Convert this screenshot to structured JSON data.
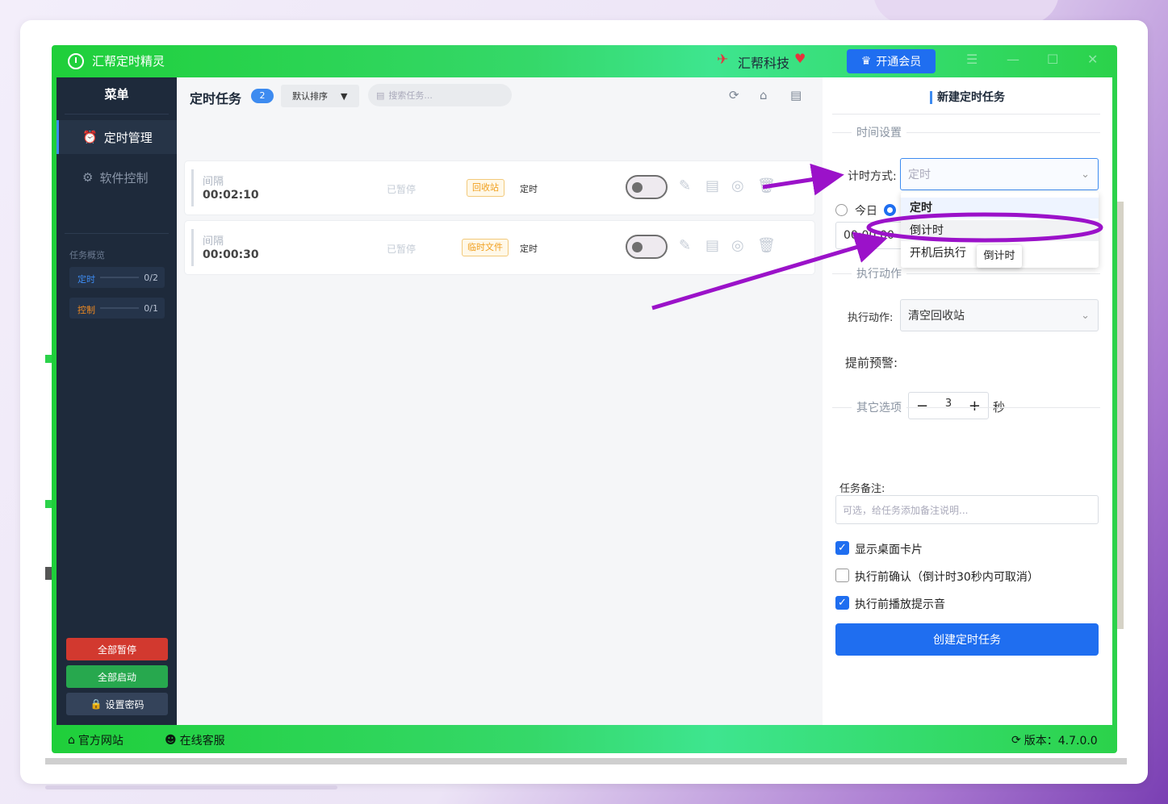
{
  "app": {
    "title": "汇帮定时精灵",
    "brand": "汇帮科技",
    "vip_label": "开通会员"
  },
  "sidebar": {
    "menu_title": "菜单",
    "items": [
      {
        "label": "定时管理",
        "icon": "alarm-clock-icon",
        "active": true
      },
      {
        "label": "软件控制",
        "icon": "gear-icon",
        "active": false
      }
    ],
    "overview_title": "任务概览",
    "overview": [
      {
        "label": "定时",
        "value": "0/2",
        "color": "#3d8bf0"
      },
      {
        "label": "控制",
        "value": "0/1",
        "color": "#f08a20"
      }
    ],
    "buttons": {
      "pause_all": "全部暂停",
      "start_all": "全部启动",
      "set_password": "设置密码"
    }
  },
  "main": {
    "title": "定时任务",
    "count": "2",
    "sort_label": "默认排序",
    "search_placeholder": "搜索任务...",
    "tasks": [
      {
        "type": "间隔",
        "time": "00:02:10",
        "status": "已暂停",
        "tag": "回收站",
        "mode": "定时",
        "enabled": false
      },
      {
        "type": "间隔",
        "time": "00:00:30",
        "status": "已暂停",
        "tag": "临时文件",
        "mode": "定时",
        "enabled": false
      }
    ]
  },
  "panel": {
    "title": "新建定时任务",
    "time_section": "时间设置",
    "timing_label": "计时方式:",
    "timing_value": "定时",
    "radio_today": "今日",
    "time_value": "00:00:00",
    "action_section": "执行动作",
    "action_label": "执行动作:",
    "action_value": "清空回收站",
    "warn_label": "提前预警:",
    "warn_value": "3",
    "warn_unit": "秒",
    "other_section": "其它选项",
    "note_label": "任务备注:",
    "note_placeholder": "可选，给任务添加备注说明...",
    "checkboxes": [
      {
        "label": "显示桌面卡片",
        "checked": true
      },
      {
        "label": "执行前确认（倒计时30秒内可取消）",
        "checked": false
      },
      {
        "label": "执行前播放提示音",
        "checked": true
      }
    ],
    "create_label": "创建定时任务"
  },
  "dropdown": {
    "options": [
      "定时",
      "倒计时",
      "开机后执行"
    ],
    "highlighted": "倒计时",
    "tooltip": "倒计时"
  },
  "statusbar": {
    "website": "官方网站",
    "support": "在线客服",
    "version": "版本：4.7.0.0"
  },
  "colors": {
    "titlebar_green": "#2bd24a",
    "sidebar_bg": "#1e2a3b",
    "primary_blue": "#1f6ef0",
    "annotation_purple": "#9b12c9"
  }
}
